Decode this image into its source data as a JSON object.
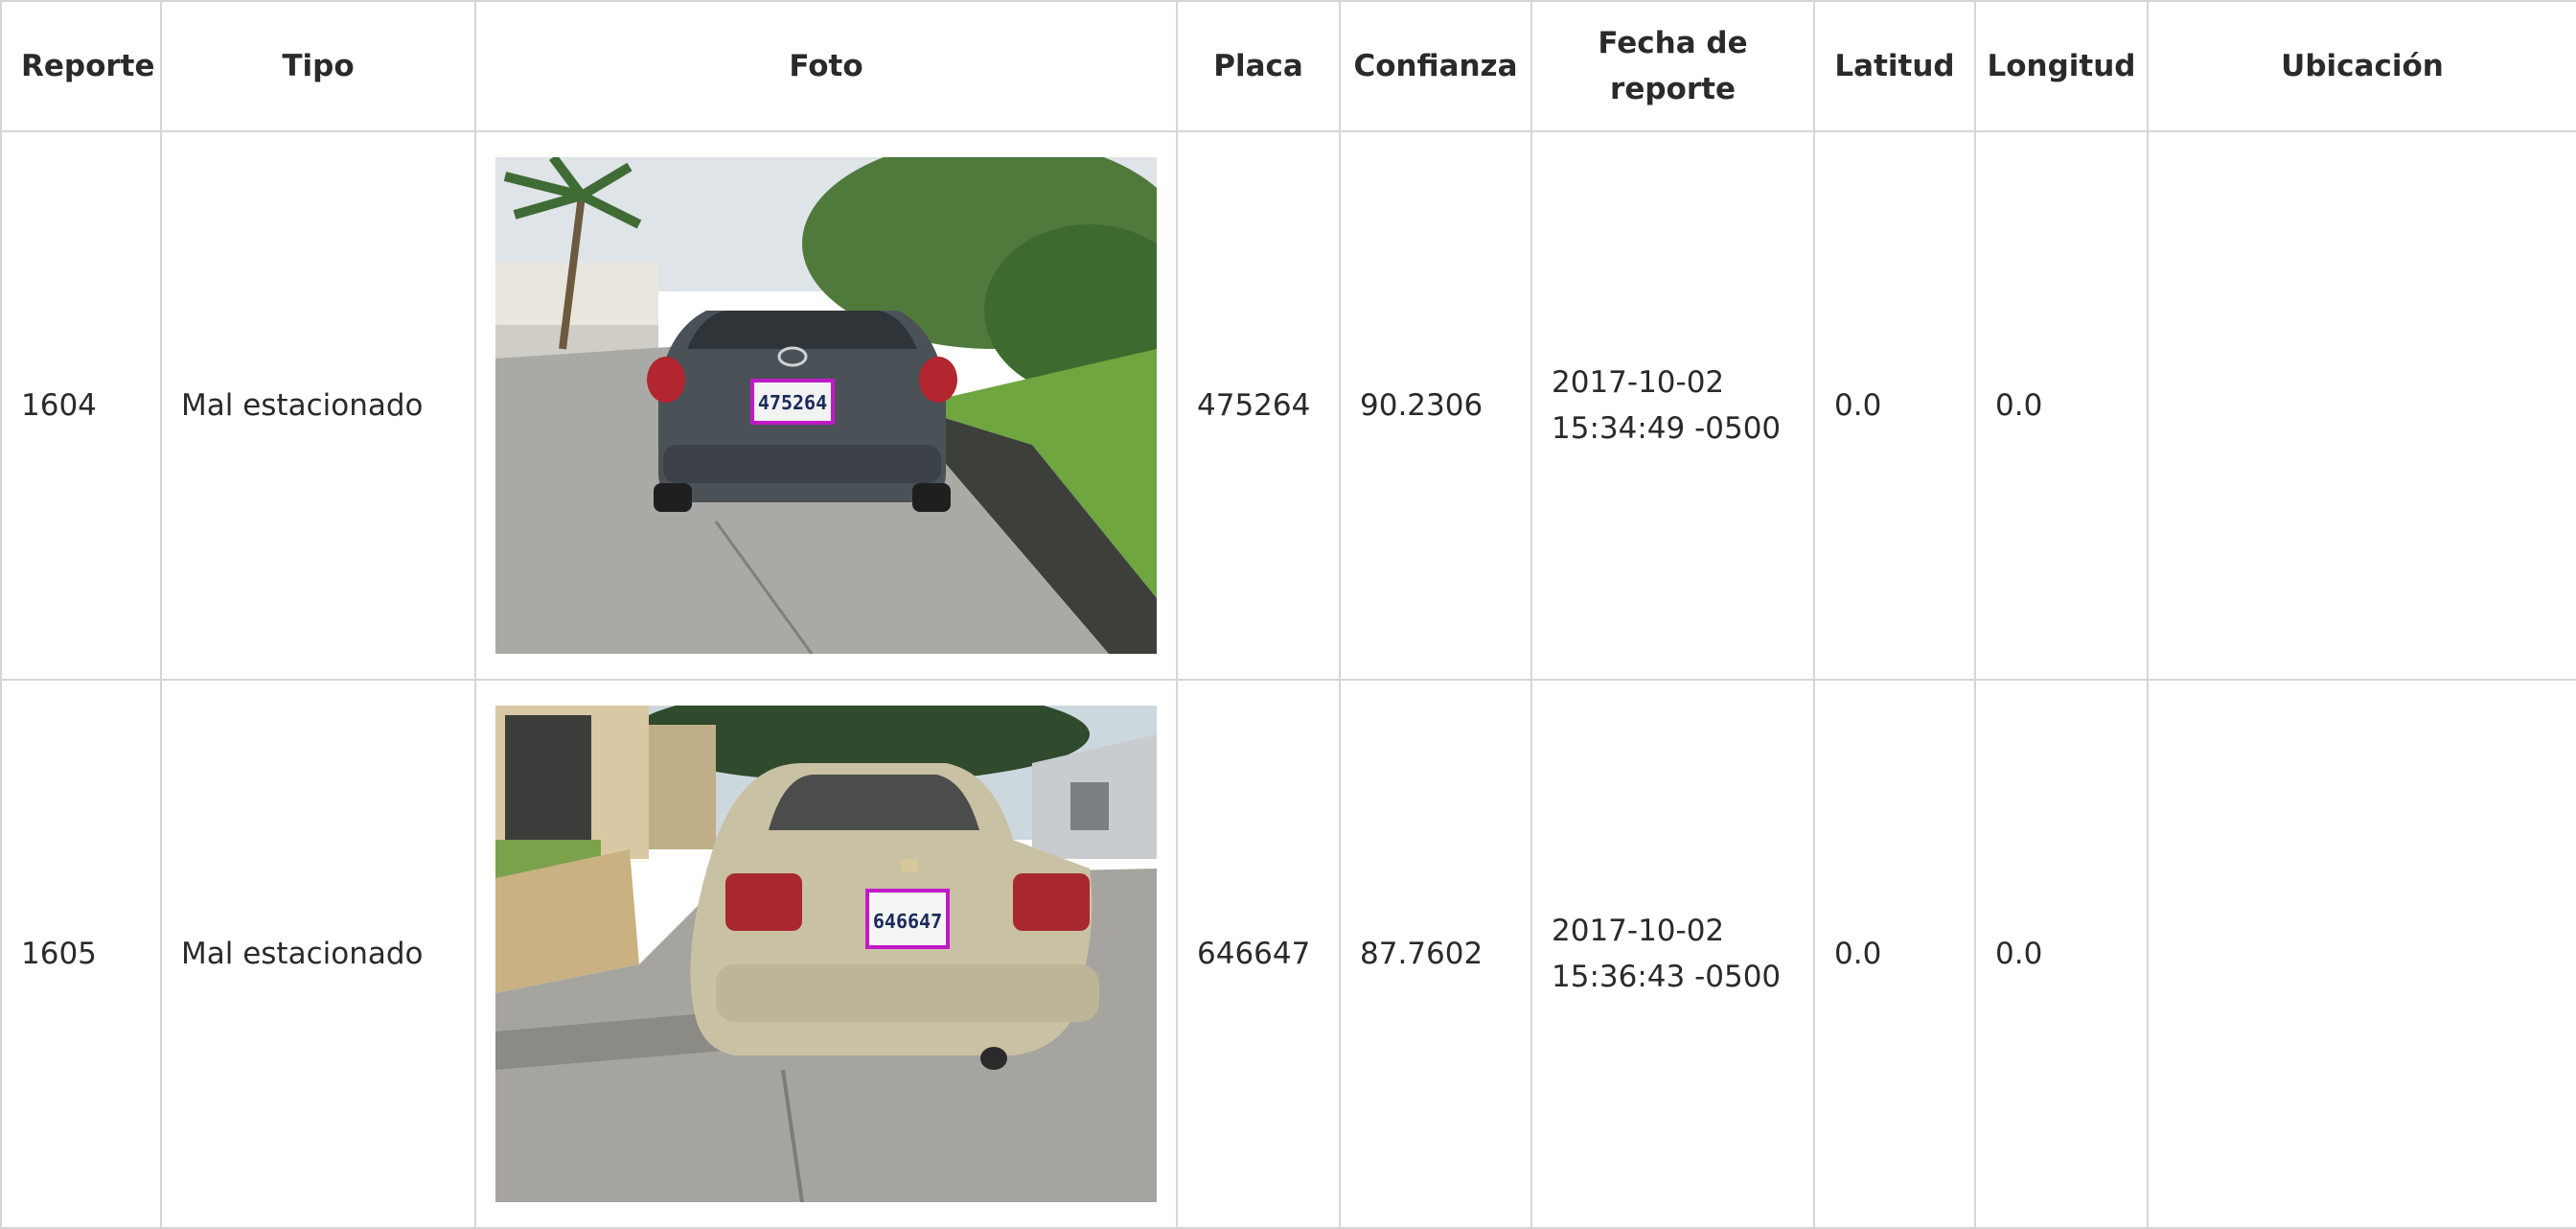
{
  "table": {
    "headers": {
      "reporte": "Reporte",
      "tipo": "Tipo",
      "foto": "Foto",
      "placa": "Placa",
      "confianza": "Confianza",
      "fecha_line1": "Fecha de",
      "fecha_line2": "reporte",
      "latitud": "Latitud",
      "longitud": "Longitud",
      "ubicacion": "Ubicación"
    },
    "rows": [
      {
        "reporte": "1604",
        "tipo": "Mal estacionado",
        "photo_plate_text": "475264",
        "car_color": "#4a5157",
        "placa": "475264",
        "confianza": "90.2306",
        "fecha_line1": "2017-10-02",
        "fecha_line2": "15:34:49 -0500",
        "latitud": "0.0",
        "longitud": "0.0",
        "ubicacion": ""
      },
      {
        "reporte": "1605",
        "tipo": "Mal estacionado",
        "photo_plate_text": "646647",
        "car_color": "#c9c1a3",
        "placa": "646647",
        "confianza": "87.7602",
        "fecha_line1": "2017-10-02",
        "fecha_line2": "15:36:43 -0500",
        "latitud": "0.0",
        "longitud": "0.0",
        "ubicacion": ""
      }
    ]
  },
  "colors": {
    "border": "#d6d6d6",
    "plate_highlight": "#c019c8",
    "text": "#2a2a2a"
  }
}
